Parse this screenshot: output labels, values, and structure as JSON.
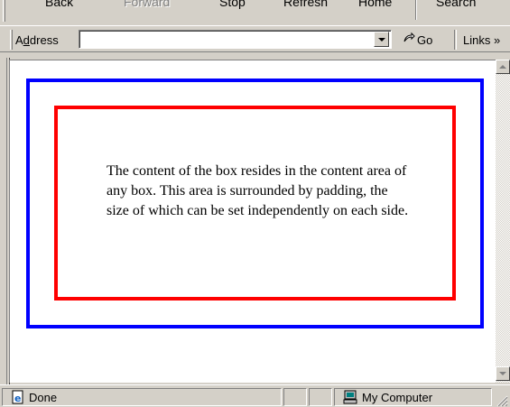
{
  "toolbar": {
    "back": "Back",
    "forward": "Forward",
    "stop": "Stop",
    "refresh": "Refresh",
    "home": "Home",
    "search": "Search"
  },
  "addressbar": {
    "label": "Address",
    "value": "",
    "go": "Go",
    "links": "Links »"
  },
  "page": {
    "content_text": "The content of the box resides in the content area of any box. This area is surrounded by padding, the size of which can be set independently on each side.",
    "outer_border_color": "#0000ff",
    "inner_border_color": "#ff0000"
  },
  "statusbar": {
    "status": "Done",
    "zone": "My Computer"
  }
}
